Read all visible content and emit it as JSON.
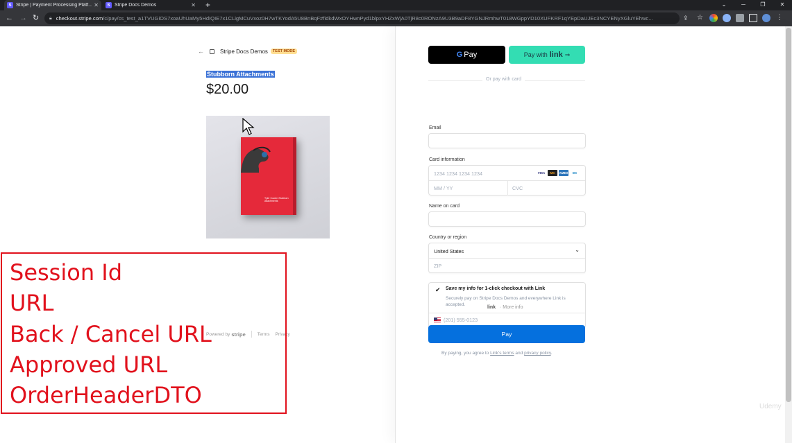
{
  "browser": {
    "tabs": [
      {
        "title": "Stripe | Payment Processing Platf..."
      },
      {
        "title": "Stripe Docs Demos"
      }
    ],
    "new_tab": "+",
    "url_host": "checkout.stripe.com",
    "url_path": "/c/pay/cs_test_a1TVUGiOS7xoaUhUaMy5HdIQIE7x1CLigMCuVxoz0H7wTKYodA5U8BnBqF#fidkdWxOYHwnPyd1blpxYHZxWjA0TjR8c0RONzA9U3B9aDF8YGNJRmhwT018WGppYD10XUFKRF1qYEpDaUJEc3NCYENyXGluYEhwc...",
    "window_controls": [
      "⌄",
      "─",
      "❐",
      "✕"
    ]
  },
  "header": {
    "back_arrow": "←",
    "store_name": "Stripe Docs Demos",
    "badge": "TEST MODE"
  },
  "product": {
    "name": "Stubborn Attachments",
    "price": "$20.00",
    "book_title": "Tyler Cowen Stubborn Attachments"
  },
  "footer": {
    "powered_by": "Powered by",
    "brand": "stripe",
    "terms": "Terms",
    "privacy": "Privacy"
  },
  "annotation": {
    "lines": [
      "Session Id",
      "URL",
      "Back / Cancel URL",
      "Approved URL",
      "OrderHeaderDTO"
    ],
    "color": "#e1111c"
  },
  "payment": {
    "gpay_label": "Pay",
    "link_button_prefix": "Pay with",
    "link_brand": "link",
    "divider_text": "Or pay with card",
    "email_label": "Email",
    "email_value": "",
    "card_label": "Card information",
    "card_number_placeholder": "1234 1234 1234 1234",
    "expiry_placeholder": "MM / YY",
    "cvc_placeholder": "CVC",
    "card_brands": [
      "VISA",
      "MC",
      "AMEX",
      "DC"
    ],
    "name_label": "Name on card",
    "country_label": "Country or region",
    "country_value": "United States",
    "zip_placeholder": "ZIP",
    "save_title": "Save my info for 1-click checkout with Link",
    "save_description": "Securely pay on Stripe Docs Demos and everywhere Link is accepted.",
    "phone_placeholder": "(201) 555-0123",
    "link_footer_brand": "link",
    "link_footer_more": "· More info",
    "pay_button": "Pay",
    "terms_prefix": "By paying, you agree to ",
    "terms_link1": "Link's terms",
    "terms_and": " and ",
    "terms_link2": "privacy policy",
    "terms_suffix": "."
  },
  "watermark": "Udemy",
  "colors": {
    "link_green": "#33ddb3",
    "pay_blue": "#0570de",
    "badge_bg": "#ffde92",
    "highlight": "#3a71d6"
  }
}
